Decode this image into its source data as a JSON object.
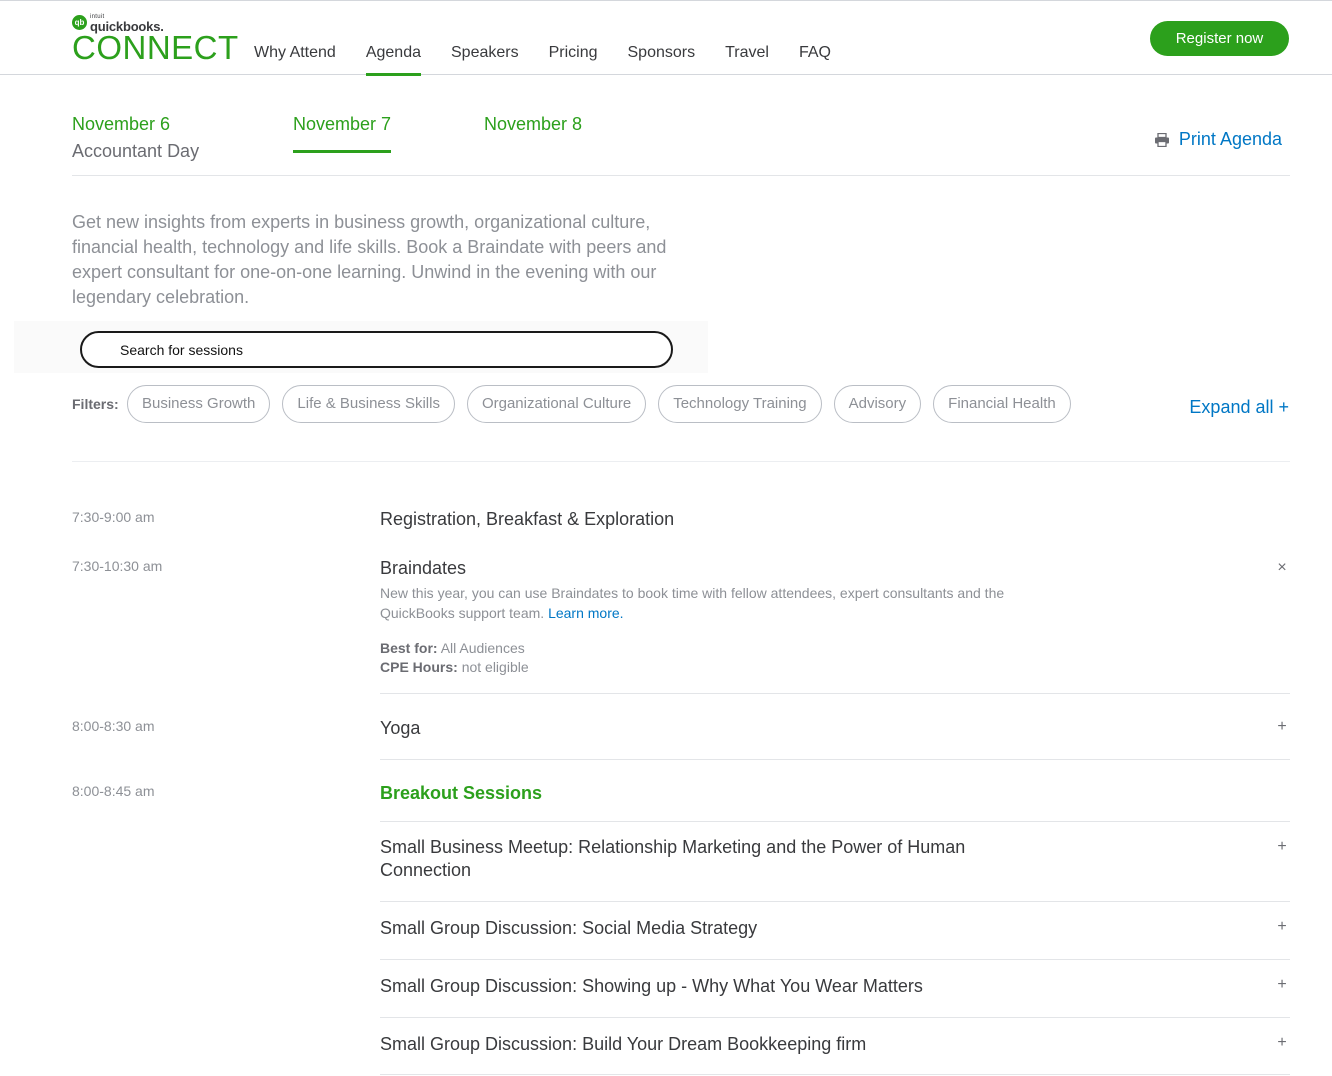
{
  "brand": {
    "intuit": "intuit",
    "quickbooks": "quickbooks.",
    "connect": "CONNECT",
    "color": "#2ca01c"
  },
  "nav": {
    "items": [
      "Why Attend",
      "Agenda",
      "Speakers",
      "Pricing",
      "Sponsors",
      "Travel",
      "FAQ"
    ],
    "active": "Agenda",
    "register_label": "Register now"
  },
  "days": {
    "tabs": [
      {
        "label": "November 6",
        "sub": "Accountant Day"
      },
      {
        "label": "November 7",
        "sub": ""
      },
      {
        "label": "November 8",
        "sub": ""
      }
    ],
    "active": "November 7",
    "print_label": "Print Agenda"
  },
  "intro": "Get new insights from experts in business growth, organizational culture, financial health, technology and life skills. Book a Braindate with peers and expert consultant for one-on-one learning. Unwind in the evening with our legendary celebration.",
  "search": {
    "placeholder": "Search for sessions"
  },
  "filters": {
    "label": "Filters:",
    "chips": [
      "Business Growth",
      "Life & Business Skills",
      "Organizational Culture",
      "Technology Training",
      "Advisory",
      "Financial Health"
    ],
    "expand_all": "Expand all +"
  },
  "agenda": {
    "sessions": [
      {
        "time": "7:30-9:00 am",
        "title": "Registration, Breakfast & Exploration"
      },
      {
        "time": "7:30-10:30 am",
        "title": "Braindates",
        "toggle": "×",
        "description": "New this year, you can use Braindates to book time with fellow attendees, expert consultants and the QuickBooks support team.",
        "link": "Learn more.",
        "best_for_label": "Best for:",
        "best_for": "All Audiences",
        "cpe_label": "CPE Hours:",
        "cpe": "not eligible"
      },
      {
        "time": "8:00-8:30 am",
        "title": "Yoga",
        "toggle": "+"
      },
      {
        "time": "8:00-8:45 am",
        "title": "Breakout Sessions"
      }
    ],
    "breakouts": [
      {
        "title": "Small Business Meetup: Relationship Marketing and the Power of Human Connection",
        "toggle": "+"
      },
      {
        "title": "Small Group Discussion: Social Media Strategy",
        "toggle": "+"
      },
      {
        "title": "Small Group Discussion: Showing up - Why What You Wear Matters",
        "toggle": "+"
      },
      {
        "title": "Small Group Discussion: Build Your Dream Bookkeeping firm",
        "toggle": "+"
      }
    ]
  },
  "colors": {
    "accent": "#2ca01c",
    "link": "#0077c5",
    "text": "#393a3d",
    "muted": "#8d9096"
  }
}
